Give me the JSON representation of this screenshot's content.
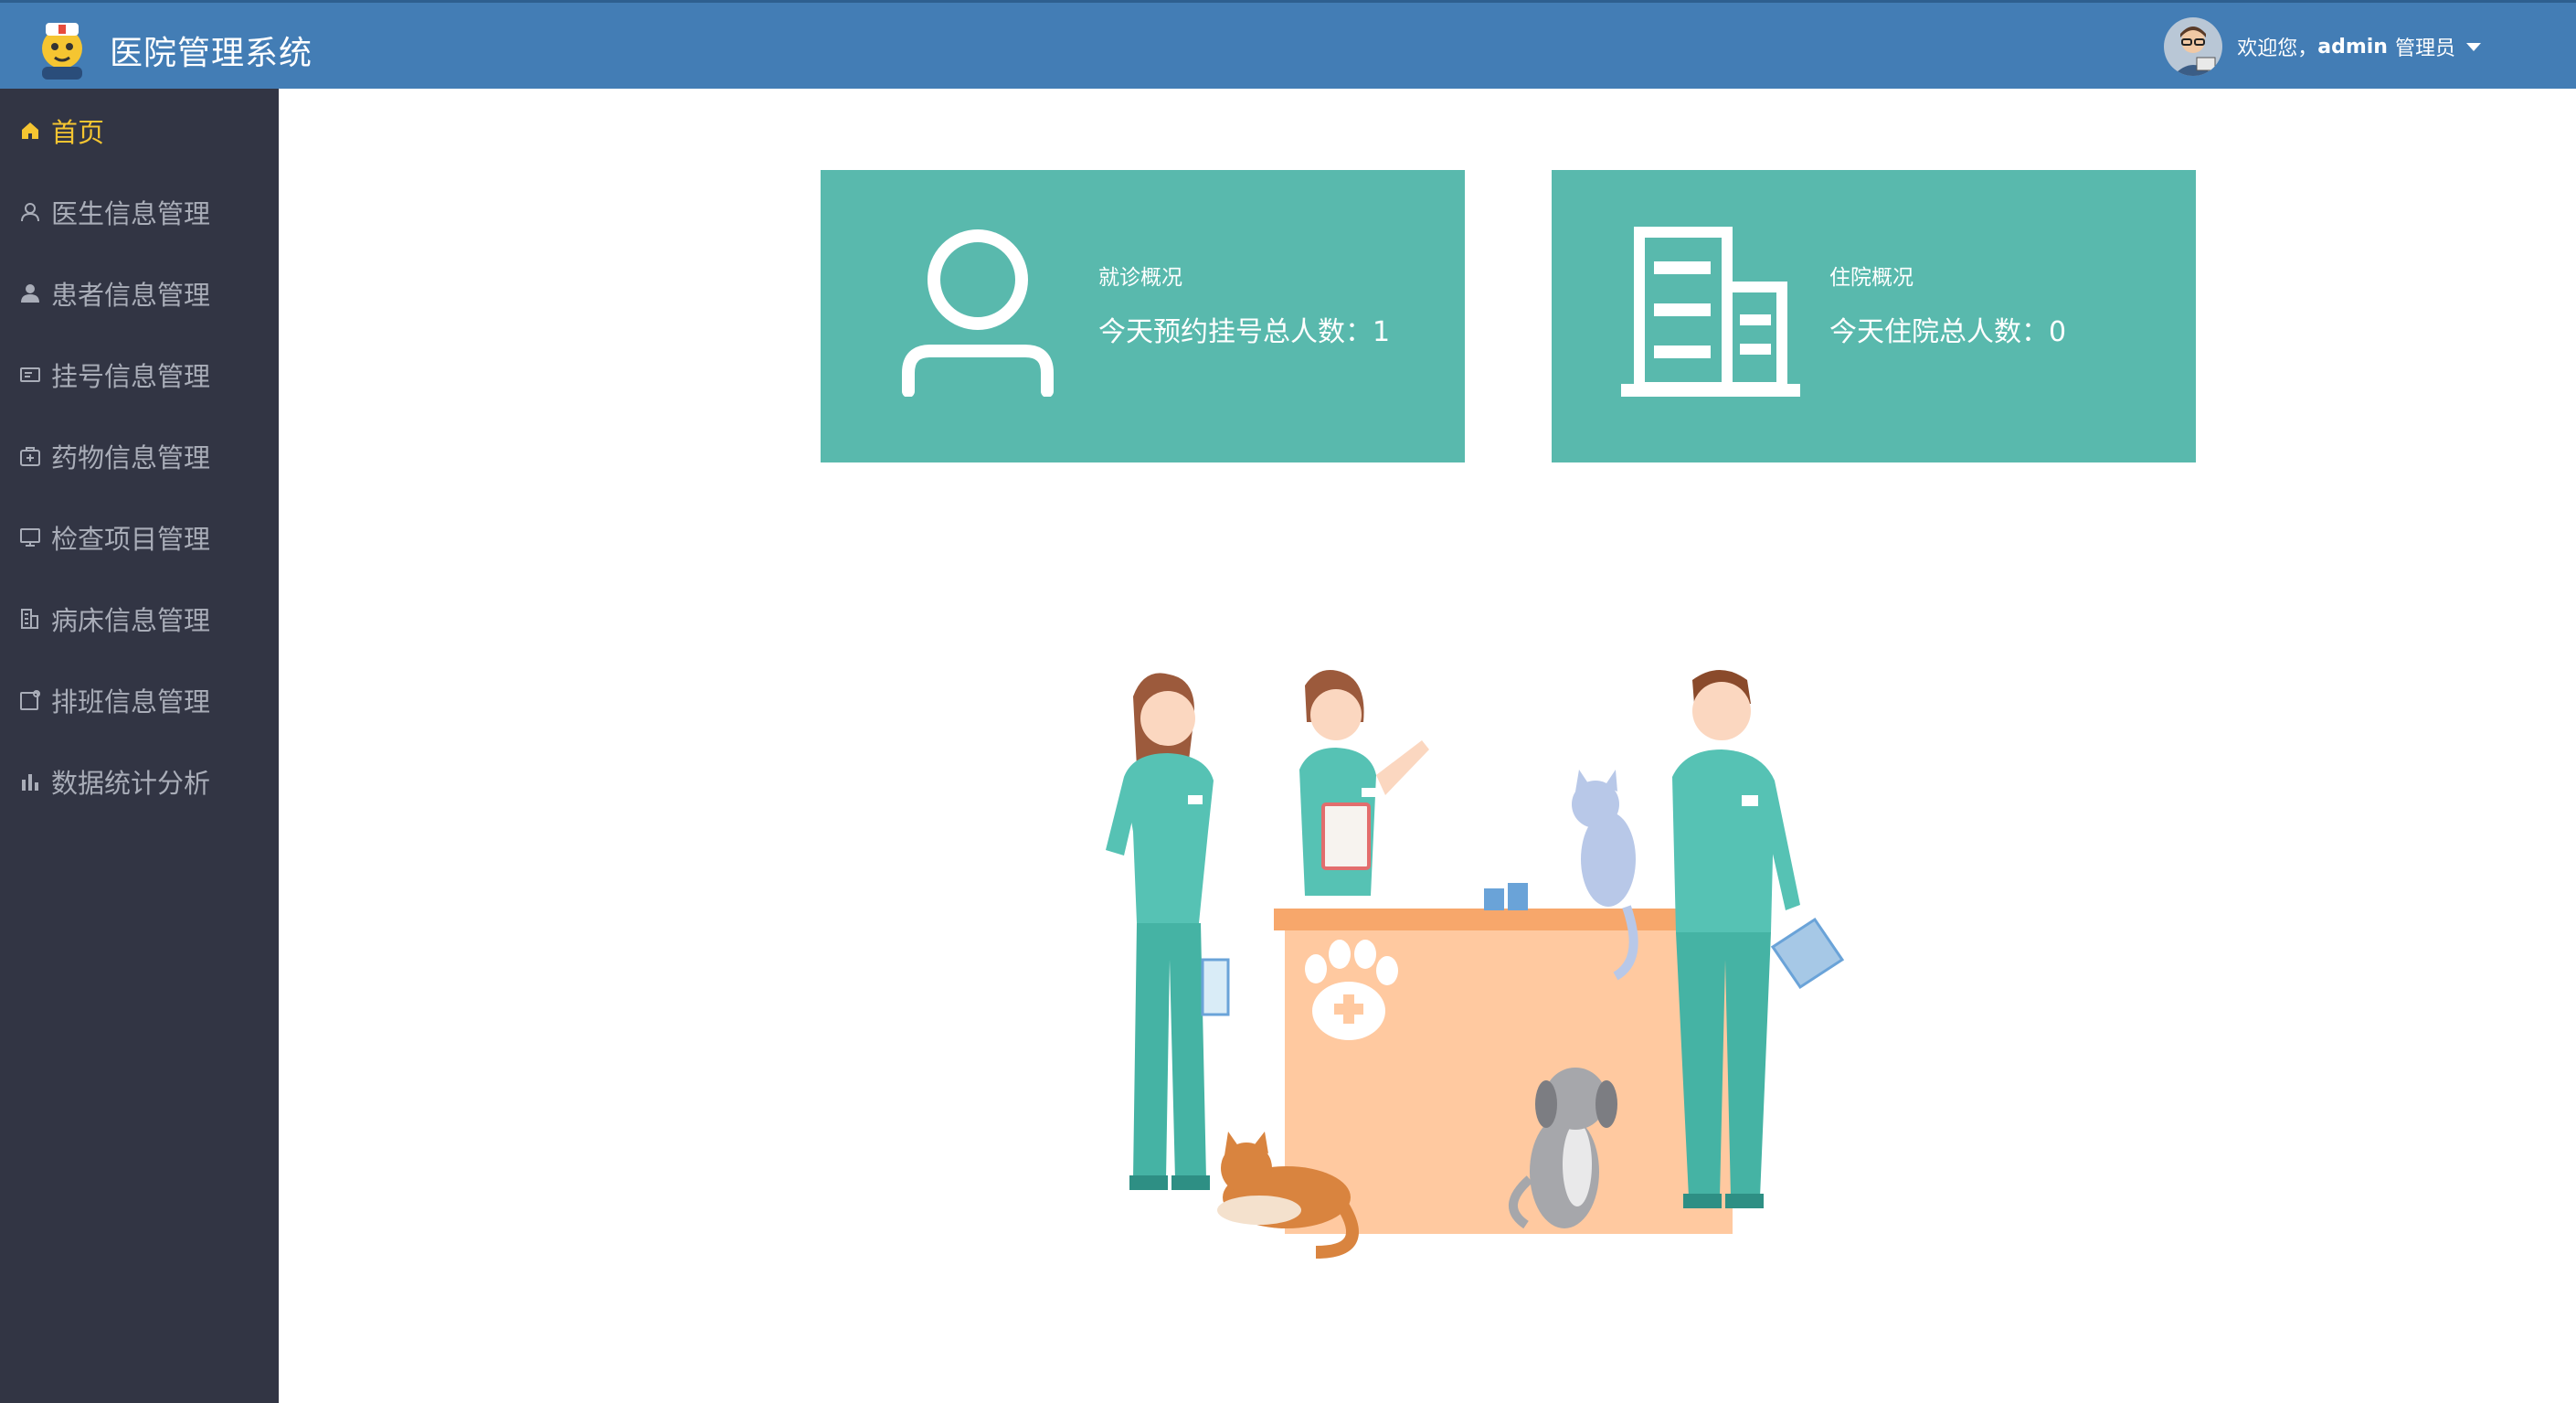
{
  "header": {
    "app_title": "医院管理系统",
    "welcome_prefix": "欢迎您，",
    "username": "admin",
    "role": "管理员"
  },
  "sidebar": {
    "items": [
      {
        "label": "首页",
        "icon": "home-icon",
        "active": true
      },
      {
        "label": "医生信息管理",
        "icon": "user-outline-icon",
        "active": false
      },
      {
        "label": "患者信息管理",
        "icon": "user-solid-icon",
        "active": false
      },
      {
        "label": "挂号信息管理",
        "icon": "id-card-icon",
        "active": false
      },
      {
        "label": "药物信息管理",
        "icon": "medicine-box-icon",
        "active": false
      },
      {
        "label": "检查项目管理",
        "icon": "monitor-icon",
        "active": false
      },
      {
        "label": "病床信息管理",
        "icon": "building-icon",
        "active": false
      },
      {
        "label": "排班信息管理",
        "icon": "calendar-icon",
        "active": false
      },
      {
        "label": "数据统计分析",
        "icon": "bar-chart-icon",
        "active": false
      }
    ]
  },
  "cards": [
    {
      "title": "就诊概况",
      "value_text": "今天预约挂号总人数：1",
      "icon": "user-outline-icon"
    },
    {
      "title": "住院概况",
      "value_text": "今天住院总人数：0",
      "icon": "building-icon"
    }
  ],
  "colors": {
    "header_bg": "#437db5",
    "sidebar_bg": "#323544",
    "sidebar_text": "#a9adb8",
    "sidebar_active": "#f5c531",
    "card_bg": "#59b9ad"
  }
}
